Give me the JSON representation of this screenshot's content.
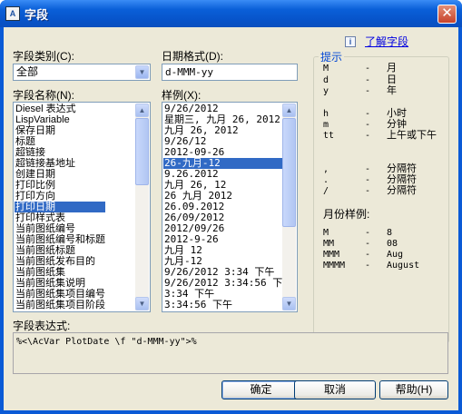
{
  "window": {
    "title": "字段",
    "app_icon": "autocad-field-icon",
    "close_label": "✕"
  },
  "left": {
    "category_label": "字段类别(C):",
    "category_value": "全部",
    "names_label": "字段名称(N):",
    "names": [
      "Diesel 表达式",
      "LispVariable",
      "保存日期",
      "标题",
      "超链接",
      "超链接基地址",
      "创建日期",
      "打印比例",
      "打印方向",
      "打印日期",
      "打印样式表",
      "当前图纸编号",
      "当前图纸编号和标题",
      "当前图纸标题",
      "当前图纸发布目的",
      "当前图纸集",
      "当前图纸集说明",
      "当前图纸集项目编号",
      "当前图纸集项目阶段"
    ],
    "names_selected": "打印日期"
  },
  "middle": {
    "date_format_label": "日期格式(D):",
    "date_format_value": "d-MMM-yy",
    "samples_label": "样例(X):",
    "samples": [
      "9/26/2012",
      "星期三, 九月 26, 2012",
      "九月 26, 2012",
      "9/26/12",
      "2012-09-26",
      "26-九月-12",
      "9.26.2012",
      "九月 26, 12",
      "26 九月 2012",
      "26.09.2012",
      "26/09/2012",
      "2012/09/26",
      "2012-9-26",
      "九月 12",
      "九月-12",
      "9/26/2012 3:34 下午",
      "9/26/2012 3:34:56 下午",
      "3:34 下午",
      "3:34:56 下午"
    ],
    "samples_selected": "26-九月-12"
  },
  "right": {
    "help_link": "了解字段",
    "hints_title": "提示",
    "hints": [
      {
        "code": "M",
        "dash": "-",
        "desc": "月"
      },
      {
        "code": "d",
        "dash": "-",
        "desc": "日"
      },
      {
        "code": "y",
        "dash": "-",
        "desc": "年"
      },
      {
        "code": "h",
        "dash": "-",
        "desc": "小时"
      },
      {
        "code": "m",
        "dash": "-",
        "desc": "分钟"
      },
      {
        "code": "tt",
        "dash": "-",
        "desc": "上午或下午"
      },
      {
        "code": ",",
        "dash": "-",
        "desc": "分隔符"
      },
      {
        "code": ".",
        "dash": "-",
        "desc": "分隔符"
      },
      {
        "code": "/",
        "dash": "-",
        "desc": "分隔符"
      }
    ],
    "month_samples_title": "月份样例:",
    "month_samples": [
      {
        "code": "M",
        "dash": "-",
        "value": "8"
      },
      {
        "code": "MM",
        "dash": "-",
        "value": "08"
      },
      {
        "code": "MMM",
        "dash": "-",
        "value": "Aug"
      },
      {
        "code": "MMMM",
        "dash": "-",
        "value": "August"
      }
    ]
  },
  "expression": {
    "label": "字段表达式:",
    "value": "%<\\AcVar PlotDate \\f \"d-MMM-yy\">%"
  },
  "buttons": {
    "ok": "确定",
    "cancel": "取消",
    "help": "帮助(H)"
  }
}
